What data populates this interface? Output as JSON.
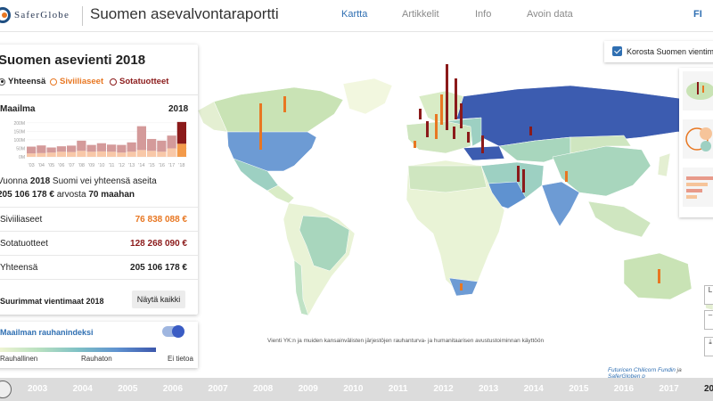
{
  "header": {
    "brand": "SaferGlobe",
    "title": "Suomen asevalvontaraportti",
    "nav": [
      "Kartta",
      "Artikkelit",
      "Info",
      "Avoin data"
    ],
    "active_nav": "Kartta",
    "language": "FI"
  },
  "panel": {
    "title": "Suomen asevienti 2018",
    "filters": [
      {
        "label": "Yhteensä",
        "selected": true,
        "color": "#222222"
      },
      {
        "label": "Siviiliaseet",
        "selected": false,
        "color": "#e87722"
      },
      {
        "label": "Sotatuotteet",
        "selected": false,
        "color": "#8b1a1a"
      }
    ],
    "section_label": "Maailma",
    "section_year": "2018",
    "summary_line1_pre": "Vuonna ",
    "summary_year": "2018",
    "summary_line1_post": " Suomi vei yhteensä aseita",
    "summary_amount": "205 106 178 €",
    "summary_mid": " arvosta ",
    "summary_countries": "70 maahan",
    "rows": [
      {
        "label": "Siviiliaseet",
        "value": "76 838 088 €",
        "color": "#e87722"
      },
      {
        "label": "Sotatuotteet",
        "value": "128 268 090 €",
        "color": "#8b1a1a"
      },
      {
        "label": "Yhteensä",
        "value": "205 106 178 €",
        "color": "#222222"
      }
    ],
    "largest_label": "Suurimmat vientimaat 2018",
    "show_all_button": "Näytä kaikki"
  },
  "chart_data": {
    "type": "bar",
    "categories": [
      "'03",
      "'04",
      "'05",
      "'06",
      "'07",
      "'08",
      "'09",
      "'10",
      "'11",
      "'12",
      "'13",
      "'14",
      "'15",
      "'16",
      "'17",
      "'18"
    ],
    "y_ticks": [
      "200M",
      "150M",
      "100M",
      "50M",
      "0M"
    ],
    "ylim": [
      0,
      220
    ],
    "series": [
      {
        "name": "Siviiliaseet",
        "values": [
          20,
          22,
          25,
          30,
          28,
          35,
          30,
          32,
          30,
          25,
          30,
          40,
          35,
          30,
          50,
          77
        ]
      },
      {
        "name": "Sotatuotteet",
        "values": [
          40,
          45,
          30,
          32,
          38,
          60,
          40,
          48,
          42,
          45,
          55,
          140,
          70,
          65,
          75,
          128
        ]
      }
    ],
    "highlight_category": "'18"
  },
  "peace_index": {
    "title": "Maailman rauhanindeksi",
    "enabled": true,
    "low_label": "Rauhallinen",
    "high_label": "Rauhaton",
    "none_label": "Ei tietoa"
  },
  "map": {
    "highlight_checkbox_label": "Korosta Suomen vientimaat",
    "highlight_checked": true,
    "caption": "Vienti YK:n ja muiden kansainvälisten järjestöjen rauhanturva- ja humanitaarisen avustustoiminnan käyttöön",
    "credits_org": "Futuricen Chilicorn Fundin",
    "credits_and": " ja ",
    "credits_org2": "SaferGloben p"
  },
  "timeline": {
    "years": [
      "2003",
      "2004",
      "2005",
      "2006",
      "2007",
      "2008",
      "2009",
      "2010",
      "2011",
      "2012",
      "2013",
      "2014",
      "2015",
      "2016",
      "2017",
      "20"
    ],
    "active_year": "20"
  }
}
